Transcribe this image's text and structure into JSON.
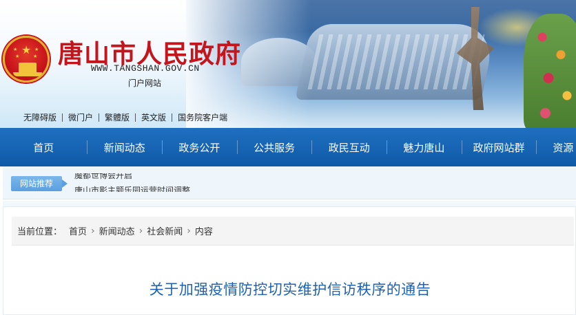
{
  "header": {
    "site_title": "唐山市人民政府",
    "domain": "WWW.TANGSHAN.GOV.CN",
    "portal_label": "门户网站",
    "quick_links": [
      "无障碍版",
      "微门户",
      "繁體版",
      "英文版",
      "国务院客户端"
    ]
  },
  "nav": {
    "items": [
      "首页",
      "新闻动态",
      "政务公开",
      "公共服务",
      "政民互动",
      "魅力唐山",
      "政府网站群",
      "资源"
    ]
  },
  "recommend": {
    "badge": "网站推荐",
    "items": [
      "魔都世博会开启",
      "唐山市影主题乐园运营时间调整"
    ]
  },
  "breadcrumb": {
    "label": "当前位置：",
    "items": [
      "首页",
      "新闻动态",
      "社会新闻",
      "内容"
    ],
    "separator": "›"
  },
  "article": {
    "title": "关于加强疫情防控切实维护信访秩序的通告"
  },
  "colors": {
    "nav_bg": "#1264b5",
    "title_red": "#c4151c",
    "article_title_blue": "#1e62b0",
    "badge_blue": "#5a9fe0"
  }
}
